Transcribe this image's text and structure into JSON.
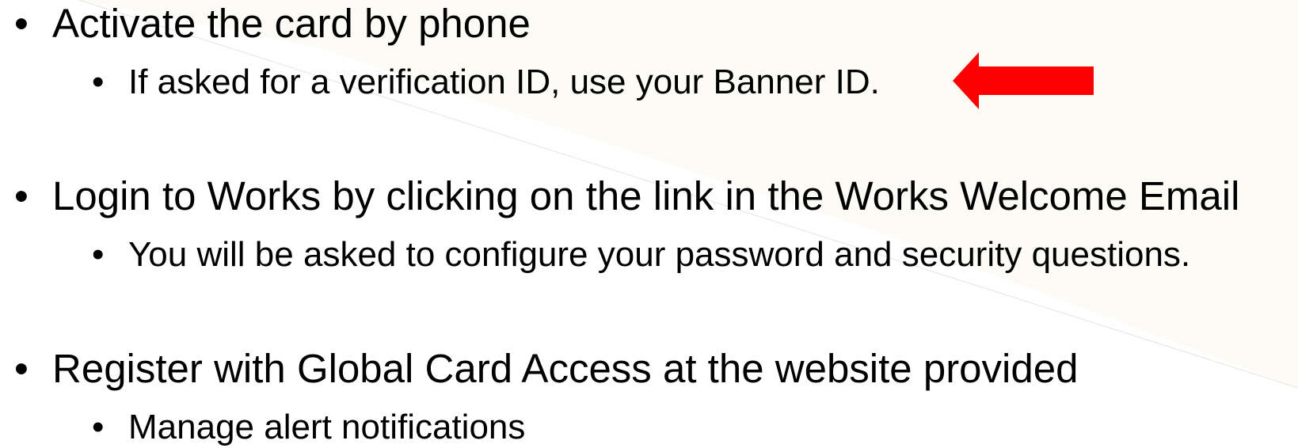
{
  "colors": {
    "background_warm": "#fdfbf6",
    "background_white": "#ffffff",
    "text": "#000000",
    "arrow": "#ff0000"
  },
  "bullets": [
    {
      "text": "Activate the card by phone",
      "sub": [
        "If asked for a verification ID, use your Banner ID."
      ]
    },
    {
      "text": "Login to Works by clicking on the link in the Works Welcome Email",
      "sub": [
        "You will be asked to configure your password and security questions."
      ]
    },
    {
      "text": "Register with Global Card Access at the website provided",
      "sub": [
        "Manage alert notifications"
      ]
    }
  ],
  "bullet_glyph": "•",
  "callout_arrow": {
    "icon": "left-arrow-icon",
    "points_to": "If asked for a verification ID, use your Banner ID."
  }
}
